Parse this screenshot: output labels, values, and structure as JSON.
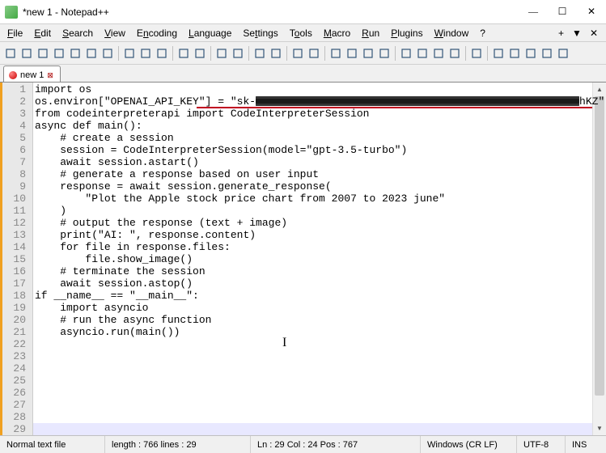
{
  "window": {
    "title": "*new 1 - Notepad++",
    "minimize": "—",
    "maximize": "☐",
    "close": "✕"
  },
  "menu": {
    "file": "File",
    "edit": "Edit",
    "search": "Search",
    "view": "View",
    "encoding": "Encoding",
    "language": "Language",
    "settings": "Settings",
    "tools": "Tools",
    "macro": "Macro",
    "run": "Run",
    "plugins": "Plugins",
    "window": "Window",
    "help": "?",
    "plus": "+",
    "dropdown": "▼",
    "x": "✕"
  },
  "toolbar_icons": [
    "new-icon",
    "open-icon",
    "save-icon",
    "save-all-icon",
    "close-icon",
    "close-all-icon",
    "print-icon",
    "sep",
    "cut-icon",
    "copy-icon",
    "paste-icon",
    "sep",
    "undo-icon",
    "redo-icon",
    "sep",
    "find-icon",
    "replace-icon",
    "sep",
    "zoom-in-icon",
    "zoom-out-icon",
    "sep",
    "sync-v-icon",
    "sync-h-icon",
    "sep",
    "wrap-icon",
    "chars-icon",
    "indent-icon",
    "lang-icon",
    "sep",
    "doc-map-icon",
    "doc-list-icon",
    "func-list-icon",
    "folder-icon",
    "sep",
    "monitor-icon",
    "sep",
    "record-icon",
    "stop-icon",
    "play-icon",
    "play-multi-icon",
    "save-macro-icon"
  ],
  "tab": {
    "label": "new 1",
    "close": "⊠"
  },
  "code_lines": [
    "import os",
    "os.environ[\"OPENAI_API_KEY\"] = \"sk-██████████████████████████████████████████████hKZ\"",
    "",
    "from codeinterpreterapi import CodeInterpreterSession",
    "",
    "",
    "async def main():",
    "    # create a session",
    "    session = CodeInterpreterSession(model=\"gpt-3.5-turbo\")",
    "    await session.astart()",
    "",
    "    # generate a response based on user input",
    "    response = await session.generate_response(",
    "        \"Plot the Apple stock price chart from 2007 to 2023 june\"",
    "    )",
    "",
    "    # output the response (text + image)",
    "    print(\"AI: \", response.content)",
    "    for file in response.files:",
    "        file.show_image()",
    "",
    "    # terminate the session",
    "    await session.astop()",
    "",
    "",
    "if __name__ == \"__main__\":",
    "    import asyncio",
    "    # run the async function",
    "    asyncio.run(main())"
  ],
  "status": {
    "filetype": "Normal text file",
    "length_lines": "length : 766    lines : 29",
    "position": "Ln : 29   Col : 24   Pos : 767",
    "eol": "Windows (CR LF)",
    "encoding": "UTF-8",
    "mode": "INS"
  }
}
